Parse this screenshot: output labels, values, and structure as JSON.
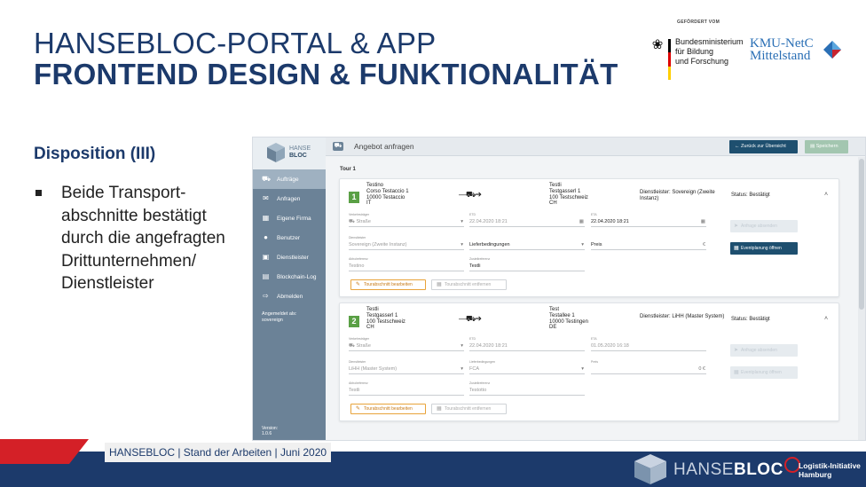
{
  "slide": {
    "title_line1": "HANSEBLOC-PORTAL & APP",
    "title_line2": "FRONTEND DESIGN & FUNKTIONALITÄT",
    "section": "Disposition (III)",
    "bullet": "Beide Transport-abschnitte bestätigt durch die angefragten Drittunternehmen/ Dienstleister"
  },
  "logos": {
    "funded_by": "GEFÖRDERT VOM",
    "bmbf": [
      "Bundesministerium",
      "für Bildung",
      "und Forschung"
    ],
    "kmu": [
      "KMU-NetC",
      "Mittelstand"
    ],
    "hansebloc_a": "HANSE",
    "hansebloc_b": "BLOC",
    "lih": [
      "Logistik-Initiative",
      "Hamburg"
    ]
  },
  "footer": {
    "text": "HANSEBLOC | Stand der Arbeiten | Juni 2020"
  },
  "app": {
    "logo_a": "HANSE",
    "logo_b": "BLOC",
    "header_title": "Angebot anfragen",
    "back_button": "Zurück zur Übersicht",
    "save_button": "Speichern",
    "nav": [
      {
        "label": "Aufträge",
        "icon": "truck-icon",
        "active": true
      },
      {
        "label": "Anfragen",
        "icon": "envelope-icon",
        "active": false
      },
      {
        "label": "Eigene Firma",
        "icon": "building-icon",
        "active": false
      },
      {
        "label": "Benutzer",
        "icon": "users-icon",
        "active": false
      },
      {
        "label": "Dienstleister",
        "icon": "briefcase-icon",
        "active": false
      },
      {
        "label": "Blockchain-Log",
        "icon": "log-icon",
        "active": false
      },
      {
        "label": "Abmelden",
        "icon": "logout-icon",
        "active": false
      }
    ],
    "logged_in_label": "Angemeldet als:",
    "logged_in_user": "sovereign",
    "version_label": "Version:",
    "version": "1.0.6",
    "tour_label": "Tour 1",
    "edit_button": "Tourabschnitt bearbeiten",
    "remove_button": "Tourabschnitt entfernen",
    "request_offer_button": "Anfrage absenden",
    "open_eventplan_button": "Eventplanung öffnen",
    "labels": {
      "carrier": "Verkehrsträger",
      "etd": "ETD",
      "eta": "ETA",
      "provider": "Dienstleister",
      "delivery_terms": "Lieferbedingungen",
      "price": "Preis",
      "pickup_ref": "Abholreferenz",
      "delivery_ref": "Zustellreferenz"
    },
    "sections": [
      {
        "number": "1",
        "from": [
          "Testino",
          "Corso Testaccio 1",
          "10000 Testaccio",
          "IT"
        ],
        "to": [
          "Testli",
          "Testgasserl 1",
          "100 Testschweiz",
          "CH"
        ],
        "provider_text": "Dienstleister: Sovereign (Zweite Instanz)",
        "status": "Status: Bestätigt",
        "carrier": "Straße",
        "etd": "22.04.2020 18:21",
        "eta": "22.04.2020 18:21",
        "provider": "Sovereign (Zweite Instanz)",
        "delivery_terms": "Lieferbedingungen",
        "price": "Preis",
        "price_currency": "€",
        "pickup_ref": "Testino",
        "delivery_ref": "Testli"
      },
      {
        "number": "2",
        "from": [
          "Testli",
          "Testgasserl 1",
          "100 Testschweiz",
          "CH"
        ],
        "to": [
          "Test",
          "Testallee 1",
          "10000 Testingen",
          "DE"
        ],
        "provider_text": "Dienstleister: LiHH (Master System)",
        "status": "Status: Bestätigt",
        "carrier": "Straße",
        "etd": "22.04.2020 18:21",
        "eta": "01.05.2020 16:18",
        "provider": "LiHH (Master System)",
        "delivery_terms": "FCA",
        "price": "0 €",
        "price_currency": "",
        "pickup_ref": "Testli",
        "delivery_ref": "Testotto"
      }
    ]
  },
  "colors": {
    "navy": "#1c3a6b",
    "red": "#d42027",
    "sidebar": "#6b8297",
    "green": "#5aa045",
    "orange": "#e8a33a"
  }
}
